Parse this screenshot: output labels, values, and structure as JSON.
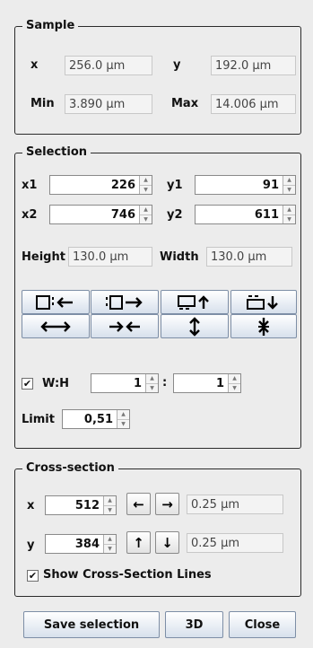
{
  "sample": {
    "title": "Sample",
    "x_label": "x",
    "x_value": "256.0 µm",
    "y_label": "y",
    "y_value": "192.0 µm",
    "min_label": "Min",
    "min_value": "3.890 µm",
    "max_label": "Max",
    "max_value": "14.006 µm"
  },
  "selection": {
    "title": "Selection",
    "x1_label": "x1",
    "x1_value": "226",
    "y1_label": "y1",
    "y1_value": "91",
    "x2_label": "x2",
    "x2_value": "746",
    "y2_label": "y2",
    "y2_value": "611",
    "height_label": "Height",
    "height_value": "130.0 µm",
    "width_label": "Width",
    "width_value": "130.0 µm",
    "tool_buttons": [
      "[]:←",
      ":[]→",
      "⊟↑",
      "⊟↓",
      "↔",
      "→←",
      "⇕",
      "⨯"
    ],
    "wh_label": "W:H",
    "wh_checked": true,
    "wh_w": "1",
    "wh_sep": ":",
    "wh_h": "1",
    "limit_label": "Limit",
    "limit_value": "0,51"
  },
  "cross_section": {
    "title": "Cross-section",
    "x_label": "x",
    "x_value": "512",
    "x_step": "0.25 µm",
    "y_label": "y",
    "y_value": "384",
    "y_step": "0.25 µm",
    "show_lines_label": "Show Cross-Section Lines",
    "show_lines_checked": true
  },
  "footer": {
    "save_label": "Save selection",
    "threed_label": "3D",
    "close_label": "Close"
  },
  "colors": {
    "background": "#ececec",
    "button_gradient_top": "#ffffff",
    "button_gradient_bottom": "#d7e0ec",
    "button_border": "#7d8ea6"
  }
}
